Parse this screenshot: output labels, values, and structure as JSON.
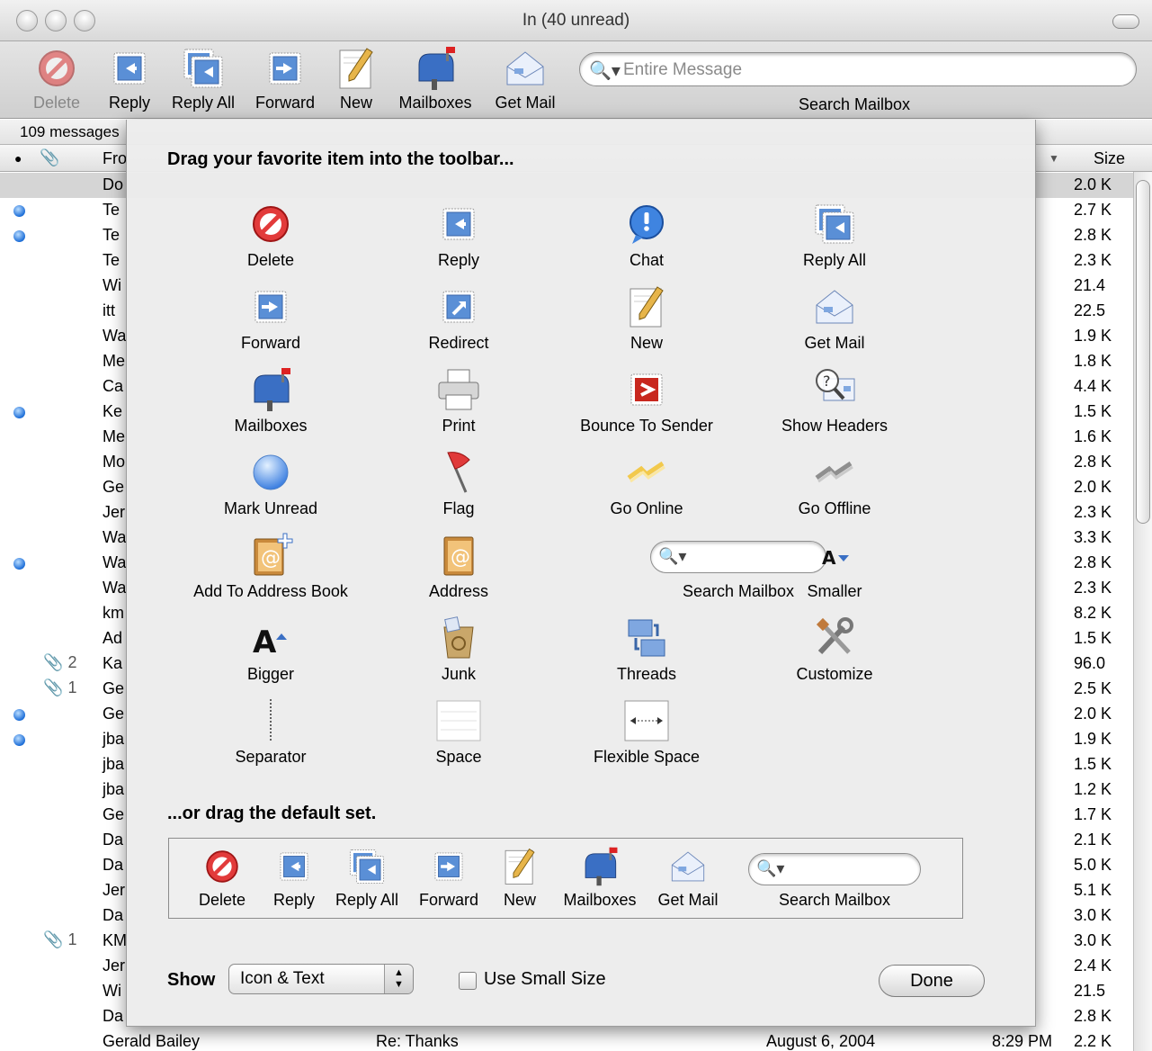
{
  "window": {
    "title": "In (40 unread)"
  },
  "toolbar": {
    "items": [
      {
        "label": "Delete",
        "icon": "delete-icon",
        "disabled": true
      },
      {
        "label": "Reply",
        "icon": "reply-icon"
      },
      {
        "label": "Reply All",
        "icon": "reply-all-icon"
      },
      {
        "label": "Forward",
        "icon": "forward-icon"
      },
      {
        "label": "New",
        "icon": "new-message-icon"
      },
      {
        "label": "Mailboxes",
        "icon": "mailboxes-icon"
      },
      {
        "label": "Get Mail",
        "icon": "get-mail-icon"
      }
    ],
    "search_placeholder": "Entire Message",
    "search_label": "Search Mailbox"
  },
  "status": {
    "message_count": "109 messages"
  },
  "columns": {
    "from": "Fro",
    "size": "Size"
  },
  "messages": [
    {
      "from": "Do",
      "size": "2.0 K",
      "selected": true
    },
    {
      "from": "Te",
      "size": "2.7 K",
      "unread": true
    },
    {
      "from": "Te",
      "size": "2.8 K",
      "unread": true
    },
    {
      "from": "Te",
      "size": "2.3 K"
    },
    {
      "from": "Wi",
      "size": "21.4"
    },
    {
      "from": "itt",
      "size": "22.5"
    },
    {
      "from": "Wa",
      "size": "1.9 K"
    },
    {
      "from": "Me",
      "size": "1.8 K"
    },
    {
      "from": "Ca",
      "size": "4.4 K"
    },
    {
      "from": "Ke",
      "size": "1.5 K",
      "unread": true
    },
    {
      "from": "Me",
      "size": "1.6 K"
    },
    {
      "from": "Mo",
      "size": "2.8 K"
    },
    {
      "from": "Ge",
      "size": "2.0 K"
    },
    {
      "from": "Jer",
      "size": "2.3 K"
    },
    {
      "from": "Wa",
      "size": "3.3 K"
    },
    {
      "from": "Wa",
      "size": "2.8 K",
      "unread": true
    },
    {
      "from": "Wa",
      "size": "2.3 K"
    },
    {
      "from": "km",
      "size": "8.2 K"
    },
    {
      "from": "Ad",
      "size": "1.5 K"
    },
    {
      "from": "Ka",
      "size": "96.0",
      "attachments": "2"
    },
    {
      "from": "Ge",
      "size": "2.5 K",
      "attachments": "1"
    },
    {
      "from": "Ge",
      "size": "2.0 K",
      "unread": true
    },
    {
      "from": "jba",
      "size": "1.9 K",
      "unread": true
    },
    {
      "from": "jba",
      "size": "1.5 K"
    },
    {
      "from": "jba",
      "size": "1.2 K"
    },
    {
      "from": "Ge",
      "size": "1.7 K"
    },
    {
      "from": "Da",
      "size": "2.1 K"
    },
    {
      "from": "Da",
      "size": "5.0 K"
    },
    {
      "from": "Jer",
      "size": "5.1 K"
    },
    {
      "from": "Da",
      "size": "3.0 K"
    },
    {
      "from": "KM",
      "size": "3.0 K",
      "attachments": "1"
    },
    {
      "from": "Jer",
      "size": "2.4 K"
    },
    {
      "from": "Wi",
      "size": "21.5"
    },
    {
      "from": "Da",
      "size": "2.8 K"
    },
    {
      "from": "Gerald Bailey",
      "subject": "Re: Thanks",
      "date": "August 6, 2004",
      "time": "8:29 PM",
      "size": "2.2 K"
    }
  ],
  "sheet": {
    "title": "Drag your favorite item into the toolbar...",
    "palette": [
      {
        "label": "Delete",
        "icon": "delete-icon"
      },
      {
        "label": "Reply",
        "icon": "reply-icon"
      },
      {
        "label": "Chat",
        "icon": "chat-icon"
      },
      {
        "label": "Reply All",
        "icon": "reply-all-icon"
      },
      {
        "label": "Forward",
        "icon": "forward-icon"
      },
      {
        "label": "Redirect",
        "icon": "redirect-icon"
      },
      {
        "label": "New",
        "icon": "new-message-icon"
      },
      {
        "label": "Get Mail",
        "icon": "get-mail-icon"
      },
      {
        "label": "Mailboxes",
        "icon": "mailboxes-icon"
      },
      {
        "label": "Print",
        "icon": "print-icon"
      },
      {
        "label": "Bounce To Sender",
        "icon": "bounce-icon"
      },
      {
        "label": "Show Headers",
        "icon": "show-headers-icon"
      },
      {
        "label": "Mark Unread",
        "icon": "mark-unread-icon"
      },
      {
        "label": "Flag",
        "icon": "flag-icon"
      },
      {
        "label": "Go Online",
        "icon": "go-online-icon"
      },
      {
        "label": "Go Offline",
        "icon": "go-offline-icon"
      },
      {
        "label": "Add To Address Book",
        "icon": "add-address-book-icon"
      },
      {
        "label": "Address",
        "icon": "address-book-icon"
      },
      {
        "label": "Search Mailbox",
        "icon": "search-icon"
      },
      {
        "label": "Smaller",
        "icon": "smaller-text-icon"
      },
      {
        "label": "Bigger",
        "icon": "bigger-text-icon"
      },
      {
        "label": "Junk",
        "icon": "junk-icon"
      },
      {
        "label": "Threads",
        "icon": "threads-icon"
      },
      {
        "label": "Customize",
        "icon": "customize-icon"
      },
      {
        "label": "Separator",
        "icon": "separator-icon"
      },
      {
        "label": "Space",
        "icon": "space-icon"
      },
      {
        "label": "Flexible Space",
        "icon": "flexible-space-icon"
      }
    ],
    "default_set_title": "...or drag the default set.",
    "default_set": [
      {
        "label": "Delete",
        "icon": "delete-icon"
      },
      {
        "label": "Reply",
        "icon": "reply-icon"
      },
      {
        "label": "Reply All",
        "icon": "reply-all-icon"
      },
      {
        "label": "Forward",
        "icon": "forward-icon"
      },
      {
        "label": "New",
        "icon": "new-message-icon"
      },
      {
        "label": "Mailboxes",
        "icon": "mailboxes-icon"
      },
      {
        "label": "Get Mail",
        "icon": "get-mail-icon"
      },
      {
        "label": "Search Mailbox",
        "icon": "search-icon"
      }
    ],
    "show_label": "Show",
    "show_value": "Icon & Text",
    "small_size_label": "Use Small Size",
    "small_size_checked": false,
    "done_label": "Done"
  },
  "colors": {
    "unread_dot": "#1d6ed8",
    "delete_red": "#d52020",
    "stamp_blue": "#5a8fd6"
  }
}
